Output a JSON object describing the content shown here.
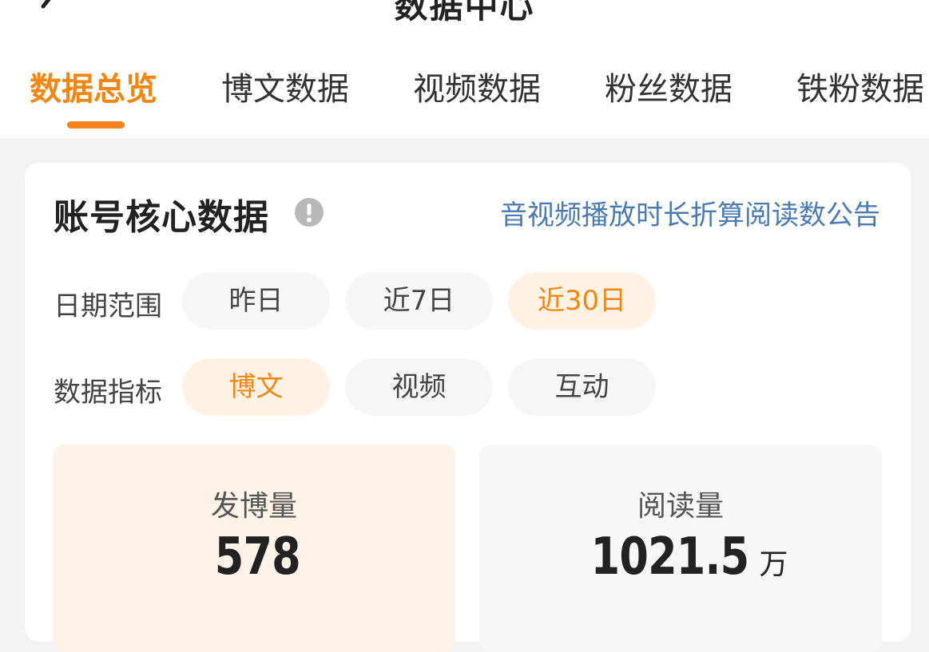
{
  "header": {
    "title": "数据中心"
  },
  "tabs": [
    {
      "label": "数据总览",
      "active": true
    },
    {
      "label": "博文数据",
      "active": false
    },
    {
      "label": "视频数据",
      "active": false
    },
    {
      "label": "粉丝数据",
      "active": false
    },
    {
      "label": "铁粉数据",
      "active": false
    }
  ],
  "card": {
    "title": "账号核心数据",
    "notice_link": "音视频播放时长折算阅读数公告",
    "date_range": {
      "label": "日期范围",
      "options": [
        "昨日",
        "近7日",
        "近30日"
      ],
      "selected": "近30日"
    },
    "metric": {
      "label": "数据指标",
      "options": [
        "博文",
        "视频",
        "互动"
      ],
      "selected": "博文"
    },
    "stats": [
      {
        "label": "发博量",
        "value": "578",
        "unit": ""
      },
      {
        "label": "阅读量",
        "value": "1021.5",
        "unit": "万"
      }
    ]
  },
  "colors": {
    "accent": "#f08714",
    "link": "#4a7bb3",
    "active_pill_bg": "#fff1e3"
  },
  "icons": {
    "back": "chevron-left-icon",
    "info": "exclamation-circle-icon"
  }
}
